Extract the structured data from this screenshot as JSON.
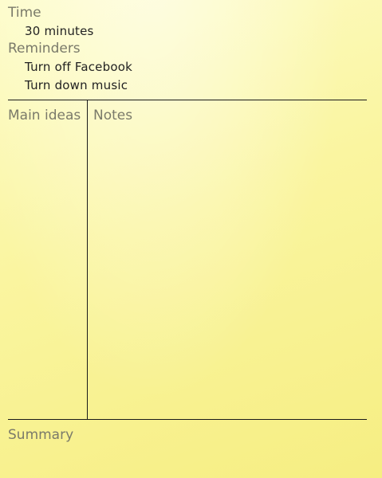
{
  "header": {
    "time_label": "Time",
    "time_value": "30 minutes",
    "reminders_label": "Reminders",
    "reminders": [
      "Turn off Facebook",
      "Turn down music"
    ]
  },
  "columns": {
    "main_ideas_label": "Main ideas",
    "notes_label": "Notes"
  },
  "footer": {
    "summary_label": "Summary"
  },
  "colors": {
    "paper": "#f9f39a",
    "heading_text": "#7a7a6a",
    "handwriting_text": "#222222",
    "rule_lines": "#1a1a1a"
  }
}
